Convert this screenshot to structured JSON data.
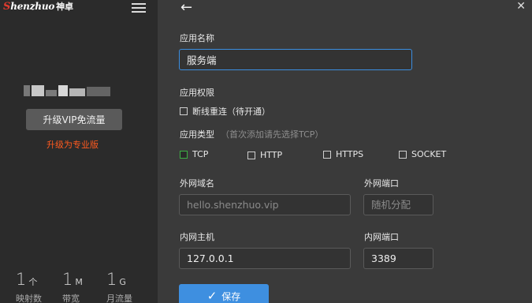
{
  "sidebar": {
    "logo_text": "Shenzhuo",
    "logo_cn": "神卓",
    "vip_button": "升级VIP免流量",
    "upgrade_link": "升级为专业版",
    "stats": [
      {
        "value": "1",
        "unit": "个",
        "label": "映射数"
      },
      {
        "value": "1",
        "unit": "M",
        "label": "带宽"
      },
      {
        "value": "1",
        "unit": "G",
        "label": "月流量"
      }
    ]
  },
  "main": {
    "app_name_label": "应用名称",
    "app_name_value": "服务端",
    "permission_label": "应用权限",
    "reconnect_label": "断线重连（待开通）",
    "type_label": "应用类型",
    "type_hint": "（首次添加请先选择TCP）",
    "types": [
      "TCP",
      "HTTP",
      "HTTPS",
      "SOCKET"
    ],
    "selected_type": "TCP",
    "external_domain_label": "外网域名",
    "external_domain_placeholder": "hello.shenzhuo.vip",
    "external_port_label": "外网端口",
    "external_port_placeholder": "随机分配",
    "internal_host_label": "内网主机",
    "internal_host_value": "127.0.0.1",
    "internal_port_label": "内网端口",
    "internal_port_value": "3389",
    "save_label": "保存"
  },
  "colors": {
    "accent": "#3e8fe0",
    "upgrade": "#ff5a1f",
    "checked": "#3cb043"
  }
}
